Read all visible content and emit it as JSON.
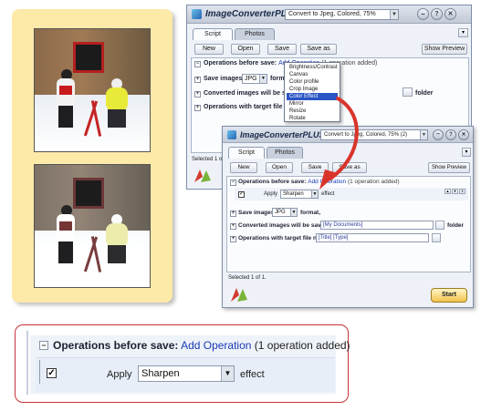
{
  "app": {
    "title": "ImageConverterPLUS",
    "preset_value": "Convert to Jpeg, Colored, 75%",
    "preset_value_2": "Convert to Jpeg, Colored, 75% (2)"
  },
  "tabs": [
    "Script",
    "Photos"
  ],
  "toolbar": {
    "new_label": "New",
    "open_label": "Open",
    "save_label": "Save",
    "save_as_label": "Save as",
    "preview_label": "Show Preview"
  },
  "sections": {
    "before_save_label": "Operations before save:",
    "add_operation_link": "Add Operation",
    "operation_count": "(1 operation added)",
    "operation_count_partial": "(1 operation added)",
    "save_images_label": "Save images in",
    "format_value": "JPG",
    "format_suffix": "format,",
    "format_suffix_cut": "format",
    "saved_to_label": "Converted images will be saved to",
    "saved_to_cut": "Converted images will be saved t",
    "folder_value": "[My Documents]",
    "folder_suffix": "folder",
    "target_name_label": "Operations with target file name",
    "target_name_value": "[Title] [Type]"
  },
  "operation_row": {
    "checked": true,
    "apply_label": "Apply",
    "effect_value": "Sharpen",
    "effect_suffix": "effect"
  },
  "menu": {
    "items": [
      "Brightness/Contrast",
      "Canvas",
      "Color profile",
      "Crop Image",
      "Color Effect",
      "Mirror",
      "Resize",
      "Rotate"
    ],
    "highlighted": "Color Effect"
  },
  "status": {
    "selected_text": "Selected 1 of 1.",
    "selected_cut": "Selected 1 o"
  },
  "start_label": "Start",
  "colors": {
    "callout_border": "#c8323a",
    "arrow": "#d9342b",
    "highlight": "#2a55c4",
    "photo_panel": "#fde9a8"
  },
  "icons": [
    "app-icon",
    "minimize-icon",
    "help-icon",
    "close-icon",
    "collapse-icon",
    "expand-icon",
    "checkbox-icon",
    "dropdown-caret-icon",
    "browse-icon",
    "move-up-icon",
    "move-down-icon",
    "delete-icon",
    "logo-icon",
    "arrow-icon"
  ]
}
